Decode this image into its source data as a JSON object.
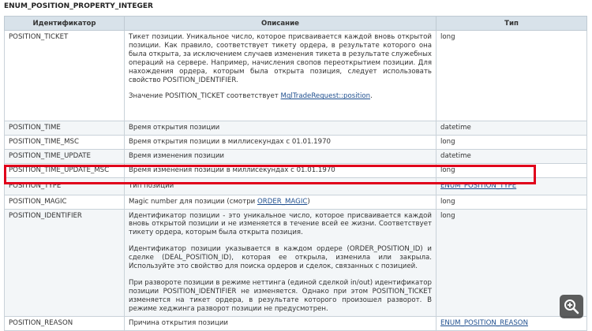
{
  "title": "ENUM_POSITION_PROPERTY_INTEGER",
  "headers": {
    "id": "Идентификатор",
    "desc": "Описание",
    "type": "Тип"
  },
  "rows": [
    {
      "id": "POSITION_TICKET",
      "desc": "Тикет позиции. Уникальное число, которое присваивается каждой вновь открытой позиции. Как правило, соответствует тикету ордера, в результате которого она была открыта, за исключением случаев изменения тикета в результате служебных операций на сервере. Например, начисления свопов переоткрытием позиции. Для нахождения ордера, которым была открыта позиция, следует использовать свойство POSITION_IDENTIFIER.",
      "desc2_before": "Значение POSITION_TICKET соответствует ",
      "desc2_link": "MqlTradeRequest::position",
      "desc2_after": ".",
      "type": "long"
    },
    {
      "id": "POSITION_TIME",
      "desc": "Время открытия позиции",
      "type": "datetime"
    },
    {
      "id": "POSITION_TIME_MSC",
      "desc": "Время открытия позиции в миллисекундах с 01.01.1970",
      "type": "long"
    },
    {
      "id": "POSITION_TIME_UPDATE",
      "desc": "Время изменения позиции",
      "type": "datetime"
    },
    {
      "id": "POSITION_TIME_UPDATE_MSC",
      "desc": "Время изменения позиции в миллисекундах с 01.01.1970",
      "type": "long"
    },
    {
      "id": "POSITION_TYPE",
      "desc": "Тип позиции",
      "type_link": "ENUM_POSITION_TYPE"
    },
    {
      "id": "POSITION_MAGIC",
      "desc_before": "Magic number для позиции (смотри ",
      "desc_link": "ORDER_MAGIC",
      "desc_after": ")",
      "type": "long"
    },
    {
      "id": "POSITION_IDENTIFIER",
      "desc_p1": "Идентификатор позиции - это уникальное число, которое присваивается каждой вновь открытой позиции и не изменяется в течение всей ее жизни. Соответствует тикету ордера, которым была открыта позиция.",
      "desc_p2": "Идентификатор позиции указывается в каждом ордере (ORDER_POSITION_ID) и сделке (DEAL_POSITION_ID), которая ее открыла, изменила или закрыла. Используйте это свойство для поиска ордеров и сделок, связанных с позицией.",
      "desc_p3": "При развороте позиции в режиме неттинга (единой сделкой in/out) идентификатор позиции POSITION_IDENTIFIER не изменяется. Однако при этом POSITION_TICKET изменяется на тикет ордера, в результате которого произошел разворот. В режиме хеджинга разворот позиции не предусмотрен.",
      "type": "long"
    },
    {
      "id": "POSITION_REASON",
      "desc": "Причина открытия позиции",
      "type_link": "ENUM_POSITION_REASON"
    }
  ],
  "zoom_icon": "zoom-in-icon"
}
